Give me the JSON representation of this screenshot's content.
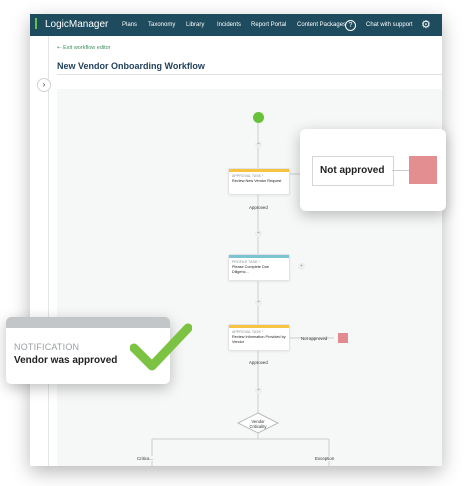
{
  "header": {
    "logo_text": "LogicManager",
    "nav": [
      {
        "label": "Plans"
      },
      {
        "label": "Taxonomy"
      },
      {
        "label": "Library"
      },
      {
        "label": "Incidents"
      },
      {
        "label": "Report Portal"
      },
      {
        "label": "Content Packages"
      }
    ],
    "help_symbol": "?",
    "chat_label": "Chat with support",
    "settings_icon": "gear-icon"
  },
  "sidebar": {
    "toggle_symbol": "›"
  },
  "page": {
    "back_link": "Exit workflow editor",
    "title": "New Vendor Onboarding Workflow"
  },
  "workflow": {
    "add_symbol": "+",
    "tasks": [
      {
        "type_label": "APPROVAL TASK *",
        "name": "Review New Vendor Request",
        "bar_color": "#f6c343"
      },
      {
        "type_label": "PROFILE TASK *",
        "name": "Please Complete Due Diligenc...",
        "bar_color": "#7cc4d1"
      },
      {
        "type_label": "APPROVAL TASK *",
        "name": "Review Information Provided by Vendor",
        "bar_color": "#f6c343"
      }
    ],
    "approved_label_1": "Approved",
    "approved_label_2": "Approved",
    "not_approved_small": "Not approved",
    "gateway_label_line1": "Vendor",
    "gateway_label_line2": "Criticality",
    "branch_left": "Critica...",
    "branch_right": "Exception",
    "colors": {
      "start": "#67c23a",
      "not_approved": "#e28a8f"
    }
  },
  "callouts": {
    "not_approved": {
      "text": "Not approved",
      "color": "#e38f91"
    },
    "notification": {
      "heading": "NOTIFICATION",
      "message": "Vendor was approved",
      "check_color": "#7cc243"
    }
  }
}
